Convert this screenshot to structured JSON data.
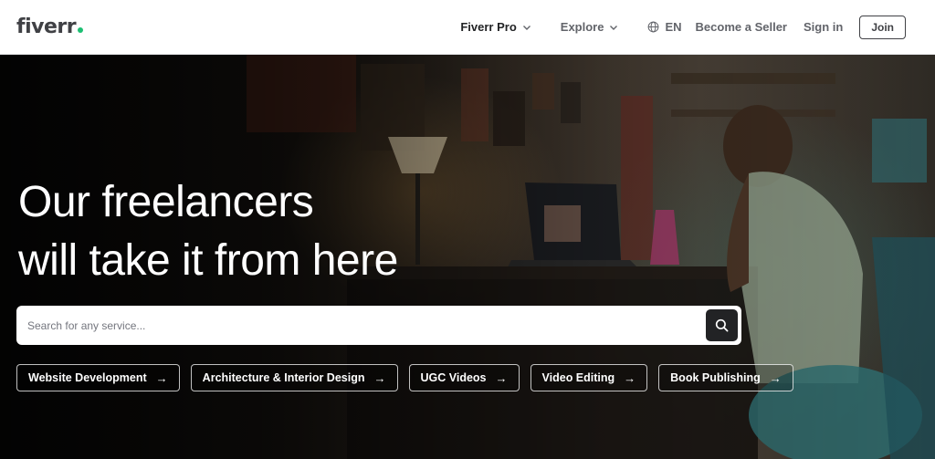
{
  "header": {
    "logo": "fiverr",
    "nav": {
      "fiverr_pro": "Fiverr Pro",
      "explore": "Explore",
      "language": "EN",
      "become_seller": "Become a Seller",
      "sign_in": "Sign in",
      "join": "Join"
    }
  },
  "hero": {
    "title_line1": "Our freelancers",
    "title_line2": "will take it from here",
    "search": {
      "placeholder": "Search for any service..."
    },
    "chips": [
      {
        "label": "Website Development",
        "arrow": "→"
      },
      {
        "label": "Architecture & Interior Design",
        "arrow": "→"
      },
      {
        "label": "UGC Videos",
        "arrow": "→"
      },
      {
        "label": "Video Editing",
        "arrow": "→"
      },
      {
        "label": "Book Publishing",
        "arrow": "→"
      }
    ]
  },
  "colors": {
    "brand_green": "#1dbf73",
    "text_dark": "#222325",
    "text_muted": "#62646a"
  }
}
